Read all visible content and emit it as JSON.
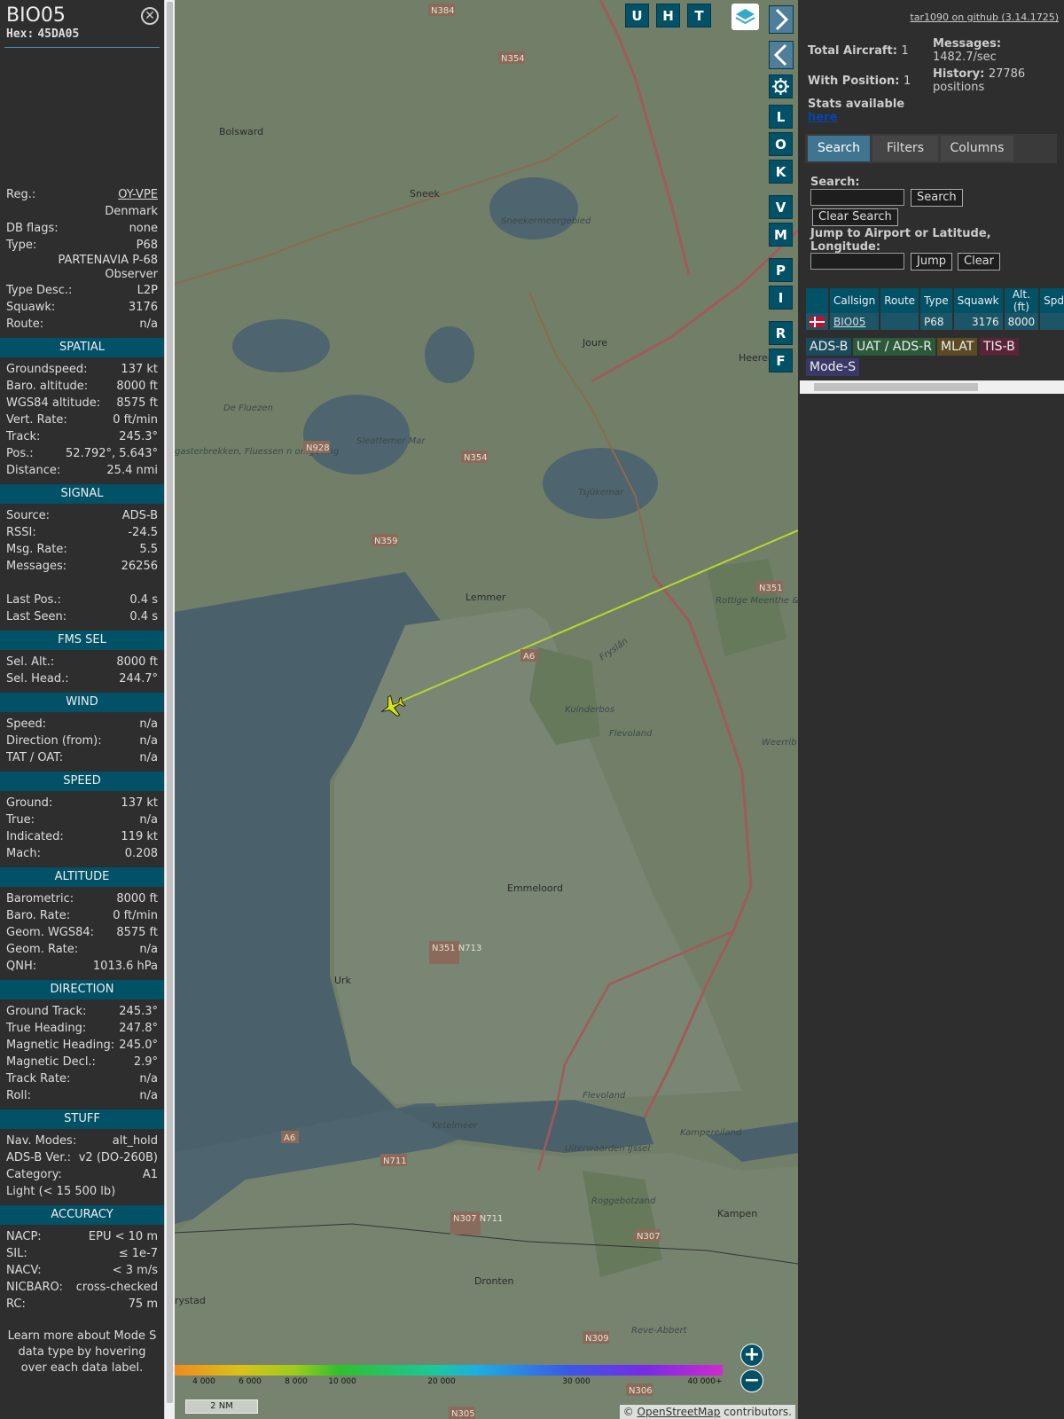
{
  "aircraft": {
    "callsign": "BIO05",
    "hex_label": "Hex:",
    "hex": "45DA05"
  },
  "info": [
    {
      "label": "Reg.:",
      "value": "OY-VPE",
      "link": true
    },
    {
      "label": "",
      "value": "Denmark"
    },
    {
      "label": "DB flags:",
      "value": "none"
    },
    {
      "label": "Type:",
      "value": "P68"
    },
    {
      "label": "",
      "value": "PARTENAVIA P-68 Observer",
      "wrap": true
    },
    {
      "label": "Type Desc.:",
      "value": "L2P"
    },
    {
      "label": "Squawk:",
      "value": "3176"
    },
    {
      "label": "Route:",
      "value": "n/a"
    }
  ],
  "sections": [
    {
      "title": "SPATIAL",
      "rows": [
        [
          "Groundspeed:",
          "137 kt"
        ],
        [
          "Baro. altitude:",
          "8000 ft"
        ],
        [
          "WGS84 altitude:",
          "8575 ft"
        ],
        [
          "Vert. Rate:",
          "0 ft/min"
        ],
        [
          "Track:",
          "245.3°"
        ],
        [
          "Pos.:",
          "52.792°, 5.643°"
        ],
        [
          "Distance:",
          "25.4 nmi"
        ]
      ]
    },
    {
      "title": "SIGNAL",
      "rows": [
        [
          "Source:",
          "ADS-B"
        ],
        [
          "RSSI:",
          "-24.5"
        ],
        [
          "Msg. Rate:",
          "5.5"
        ],
        [
          "Messages:",
          "26256"
        ],
        [
          "",
          ""
        ],
        [
          "Last Pos.:",
          "0.4 s"
        ],
        [
          "Last Seen:",
          "0.4 s"
        ]
      ]
    },
    {
      "title": "FMS SEL",
      "rows": [
        [
          "Sel. Alt.:",
          "8000 ft"
        ],
        [
          "Sel. Head.:",
          "244.7°"
        ]
      ]
    },
    {
      "title": "WIND",
      "rows": [
        [
          "Speed:",
          "n/a"
        ],
        [
          "Direction (from):",
          "n/a"
        ],
        [
          "TAT / OAT:",
          "n/a"
        ]
      ]
    },
    {
      "title": "SPEED",
      "rows": [
        [
          "Ground:",
          "137 kt"
        ],
        [
          "True:",
          "n/a"
        ],
        [
          "Indicated:",
          "119 kt"
        ],
        [
          "Mach:",
          "0.208"
        ]
      ]
    },
    {
      "title": "ALTITUDE",
      "rows": [
        [
          "Barometric:",
          "8000 ft"
        ],
        [
          "Baro. Rate:",
          "0 ft/min"
        ],
        [
          "Geom. WGS84:",
          "8575 ft"
        ],
        [
          "Geom. Rate:",
          "n/a"
        ],
        [
          "QNH:",
          "1013.6 hPa"
        ]
      ]
    },
    {
      "title": "DIRECTION",
      "rows": [
        [
          "Ground Track:",
          "245.3°"
        ],
        [
          "True Heading:",
          "247.8°"
        ],
        [
          "Magnetic Heading:",
          "245.0°"
        ],
        [
          "Magnetic Decl.:",
          "2.9°"
        ],
        [
          "Track Rate:",
          "n/a"
        ],
        [
          "Roll:",
          "n/a"
        ]
      ]
    },
    {
      "title": "STUFF",
      "rows": [
        [
          "Nav. Modes:",
          "alt_hold"
        ],
        [
          "ADS-B Ver.:",
          "v2 (DO-260B)"
        ],
        [
          "Category:",
          "A1"
        ],
        [
          "Light (< 15 500 lb)",
          ""
        ]
      ]
    },
    {
      "title": "ACCURACY",
      "rows": [
        [
          "NACP:",
          "EPU < 10 m"
        ],
        [
          "SIL:",
          "≤ 1e-7"
        ],
        [
          "NACV:",
          "< 3 m/s"
        ],
        [
          "NICBARO:",
          "cross-checked"
        ],
        [
          "RC:",
          "75 m"
        ]
      ]
    }
  ],
  "sidebar_footer": "Learn more about Mode S data type by hovering over each data label.",
  "map": {
    "top_buttons": [
      "U",
      "H",
      "T"
    ],
    "side_buttons": [
      "L",
      "O",
      "K",
      "V",
      "M",
      "P",
      "I",
      "R",
      "F"
    ],
    "alt_ticks": [
      "4 000",
      "6 000",
      "8 000",
      "10 000",
      "20 000",
      "30 000",
      "40 000+"
    ],
    "scale": "2 NM",
    "attribution_prefix": "© ",
    "attribution_link": "OpenStreetMap",
    "attribution_suffix": " contributors.",
    "places": [
      {
        "name": "Bolsward"
      },
      {
        "name": "Sneek"
      },
      {
        "name": "Joure"
      },
      {
        "name": "Heeren"
      },
      {
        "name": "Lemmer"
      },
      {
        "name": "Emmeloord"
      },
      {
        "name": "Urk"
      },
      {
        "name": "Dronten"
      },
      {
        "name": "Kampen"
      },
      {
        "name": "Kampereiland"
      },
      {
        "name": "Flevoland"
      },
      {
        "name": "Flevoland"
      },
      {
        "name": "Fryslân"
      },
      {
        "name": "Kuinderbos"
      },
      {
        "name": "Ketelmeer"
      },
      {
        "name": "Sneekermeergebied"
      },
      {
        "name": "Tsjûkemar"
      },
      {
        "name": "Sleattemer Mar"
      },
      {
        "name": "De Fluezen"
      },
      {
        "name": "Rottige Meenthe & Brandemeer"
      },
      {
        "name": "Weerrib"
      },
      {
        "name": "Roggebotzand"
      },
      {
        "name": "Reve-Abbert"
      },
      {
        "name": "Uiterwaarden IJssel"
      },
      {
        "name": "rystad"
      },
      {
        "name": "gasterbrekken, Fluessen n omgeving"
      }
    ],
    "roads": [
      "N384",
      "N354",
      "N928",
      "N354",
      "N359",
      "N351",
      "A6",
      "N351 N713",
      "A6",
      "N711",
      "N307 N711",
      "N307",
      "N309",
      "N306",
      "N305"
    ]
  },
  "panel": {
    "github": "tar1090 on github (3.14.1725)",
    "total_aircraft_label": "Total Aircraft:",
    "total_aircraft": "1",
    "with_position_label": "With Position:",
    "with_position": "1",
    "messages_label": "Messages:",
    "messages": "1482.7/sec",
    "history_label": "History:",
    "history": "27786 positions",
    "stats_label": "Stats available",
    "stats_link": "here",
    "tabs": [
      "Search",
      "Filters",
      "Columns"
    ],
    "search_label": "Search:",
    "search_button": "Search",
    "clear_search_button": "Clear Search",
    "jump_label": "Jump to Airport or Latitude, Longitude:",
    "jump_button": "Jump",
    "clear_button": "Clear",
    "table_headers": [
      "",
      "Callsign",
      "Route",
      "Type",
      "Squawk",
      "Alt. (ft)",
      "Spd."
    ],
    "table_row": {
      "callsign": "BIO05",
      "route": "",
      "type": "P68",
      "squawk": "3176",
      "alt": "8000",
      "spd": ""
    },
    "sources": [
      {
        "label": "ADS-B",
        "color": "#1b4a5a"
      },
      {
        "label": "UAT / ADS-R",
        "color": "#2a5a3a"
      },
      {
        "label": "MLAT",
        "color": "#5c4a25"
      },
      {
        "label": "TIS-B",
        "color": "#5a2438"
      },
      {
        "label": "Mode-S",
        "color": "#3a3868"
      }
    ]
  },
  "colors": {
    "accent": "#015167",
    "track": "#b8d82a",
    "aircraft": "#d4e617"
  }
}
